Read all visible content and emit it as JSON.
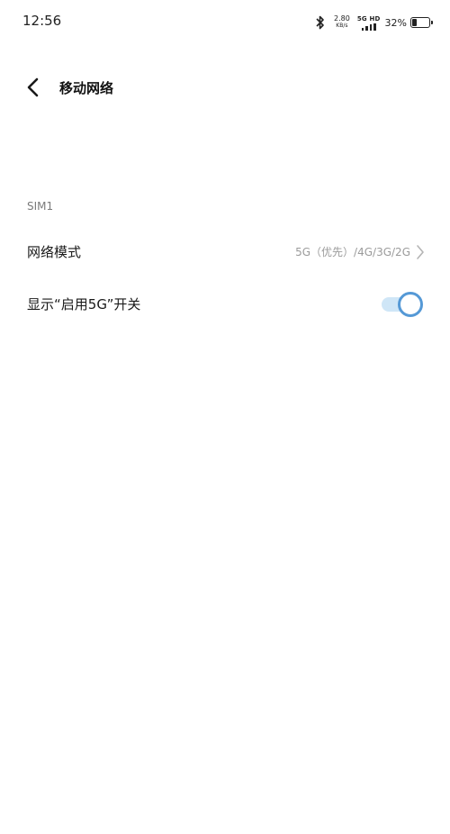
{
  "status_bar": {
    "time": "12:56",
    "net_speed_value": "2.80",
    "net_speed_unit": "KB/s",
    "signal_label": "5G HD",
    "battery_percent": "32%",
    "battery_level": 0.32,
    "icons": [
      "bluetooth-icon",
      "signal-icon",
      "battery-icon"
    ]
  },
  "header": {
    "title": "移动网络",
    "back_icon": "back-arrow-icon"
  },
  "sections": [
    {
      "label": "SIM1",
      "rows": [
        {
          "label": "网络模式",
          "value": "5G（优先）/4G/3G/2G",
          "icon": "chevron-right-icon"
        },
        {
          "label": "显示“启用5G”开关",
          "toggle_on": true
        }
      ]
    }
  ],
  "colors": {
    "toggle_accent": "#5599d6",
    "toggle_track": "#cfe6f7",
    "secondary_text": "#9b9b9b"
  }
}
